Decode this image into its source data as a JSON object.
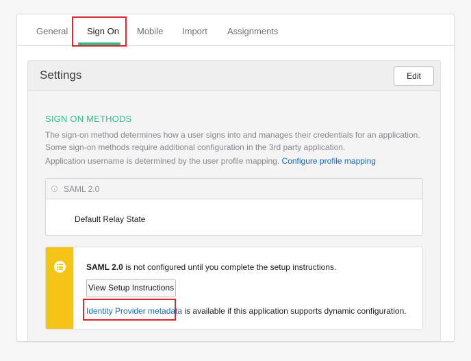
{
  "tabs": {
    "items": [
      {
        "label": "General",
        "active": false
      },
      {
        "label": "Sign On",
        "active": true
      },
      {
        "label": "Mobile",
        "active": false
      },
      {
        "label": "Import",
        "active": false
      },
      {
        "label": "Assignments",
        "active": false
      }
    ]
  },
  "settings": {
    "title": "Settings",
    "edit_label": "Edit"
  },
  "sign_on_methods": {
    "heading": "SIGN ON METHODS",
    "description": "The sign-on method determines how a user signs into and manages their credentials for an application. Some sign-on methods require additional configuration in the 3rd party application.",
    "username_prefix": "Application username is determined by the user profile mapping. ",
    "username_link": "Configure profile mapping"
  },
  "saml": {
    "option_label": "SAML 2.0",
    "relay_state_label": "Default Relay State"
  },
  "notice": {
    "strong_text": "SAML 2.0",
    "message": " is not configured until you complete the setup instructions.",
    "setup_button_label": "View Setup Instructions",
    "metadata_link": "Identity Provider metadata",
    "metadata_suffix": " is available if this application supports dynamic configuration."
  },
  "colors": {
    "accent_green": "#2fbb8f",
    "link_blue": "#1568b8",
    "warning_yellow": "#f5c416",
    "highlight_red": "#e0242d"
  },
  "icons": [
    "radio-icon",
    "list-icon"
  ]
}
